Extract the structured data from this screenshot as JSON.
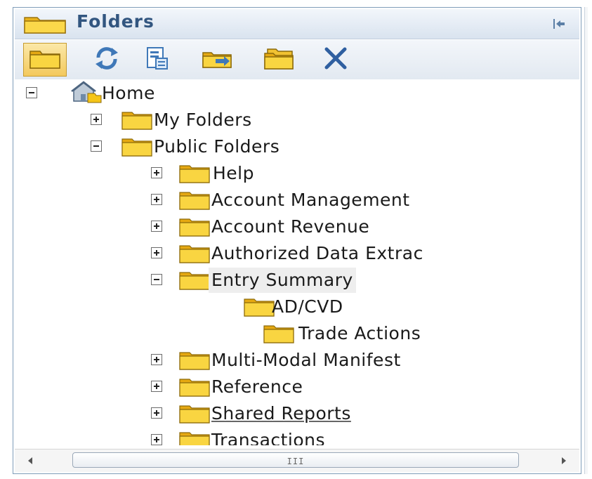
{
  "panel": {
    "title": "Folders",
    "collapse_icon": "collapse-left-icon"
  },
  "toolbar": {
    "buttons": [
      {
        "name": "show-folders",
        "icon": "folder-icon",
        "selected": true
      },
      {
        "name": "refresh",
        "icon": "refresh-icon",
        "selected": false
      },
      {
        "name": "properties",
        "icon": "document-edit-icon",
        "selected": false
      },
      {
        "name": "move",
        "icon": "move-folder-icon",
        "selected": false
      },
      {
        "name": "new-folder",
        "icon": "new-folder-icon",
        "selected": false
      },
      {
        "name": "delete",
        "icon": "delete-x-icon",
        "selected": false
      }
    ]
  },
  "tree": {
    "home": {
      "label": "Home",
      "expanded": true,
      "icon": "home-icon"
    },
    "my_folders": {
      "label": "My Folders",
      "expanded": false
    },
    "public_folders": {
      "label": "Public Folders",
      "expanded": true
    },
    "help": {
      "label": " Help",
      "expanded": false
    },
    "account_management": {
      "label": "Account Management",
      "expanded": false
    },
    "account_revenue": {
      "label": "Account Revenue",
      "expanded": false
    },
    "authorized_data_extract": {
      "label": "Authorized Data Extrac",
      "expanded": false
    },
    "entry_summary": {
      "label": "Entry Summary",
      "expanded": true
    },
    "ad_cvd": {
      "label": "AD/CVD"
    },
    "trade_actions": {
      "label": "Trade Actions"
    },
    "multi_modal_manifest": {
      "label": "Multi-Modal Manifest",
      "expanded": false
    },
    "reference": {
      "label": "Reference",
      "expanded": false
    },
    "shared_reports": {
      "label": "Shared Reports",
      "expanded": false
    },
    "transactions": {
      "label": "Transactions",
      "expanded": false
    }
  },
  "scrollbar": {
    "grip": "III"
  },
  "colors": {
    "title": "#325680",
    "folder": "#f5c518",
    "border": "#7f9db9"
  }
}
